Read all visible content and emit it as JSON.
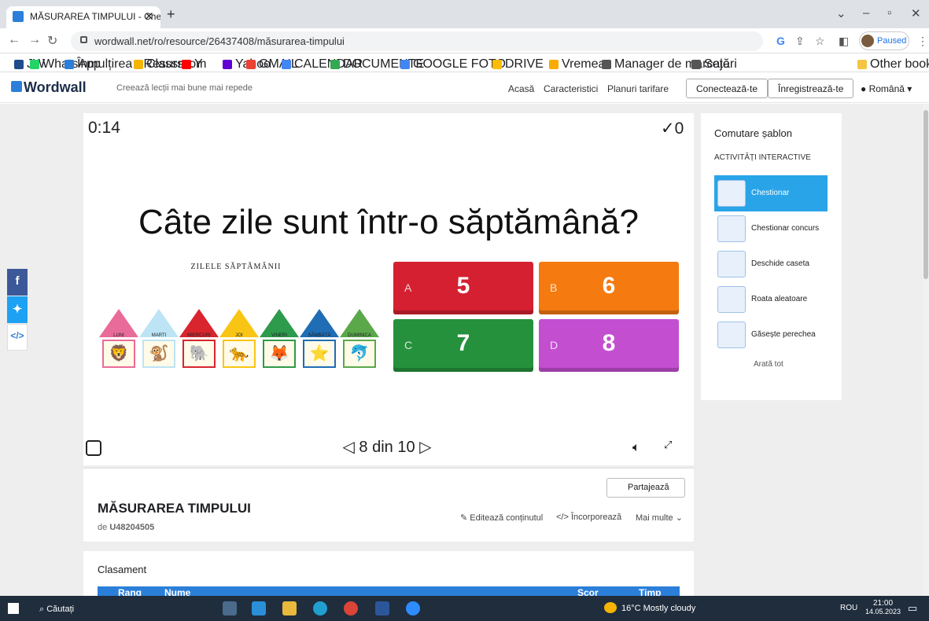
{
  "browser": {
    "tab_title": "MĂSURAREA TIMPULUI - Chestio",
    "url": "wordwall.net/ro/resource/26437408/măsurarea-timpului",
    "profile_status": "Paused",
    "bookmarks": [
      {
        "label": "JW",
        "color": "#1f4c8c"
      },
      {
        "label": "WhatsApp",
        "color": "#25d366"
      },
      {
        "label": "Înmulțirea - Resurs...",
        "color": "#2b7fd9"
      },
      {
        "label": "Classroom",
        "color": "#f4b400"
      },
      {
        "label": "Y",
        "color": "#ff0000"
      },
      {
        "label": "Yahoo",
        "color": "#6001d2"
      },
      {
        "label": "GMAIL",
        "color": "#ea4335"
      },
      {
        "label": "CALENDAR",
        "color": "#4285f4"
      },
      {
        "label": "DOCUMENTE",
        "color": "#34a853"
      },
      {
        "label": "GOOGLE FOTO",
        "color": "#4285f4"
      },
      {
        "label": "DRIVE",
        "color": "#fbbc04"
      },
      {
        "label": "Vremea",
        "color": "#f9ab00"
      },
      {
        "label": "Manager de marcaje",
        "color": "#555555"
      },
      {
        "label": "Setări",
        "color": "#555555"
      }
    ],
    "other_bookmarks": "Other bookmarks"
  },
  "site": {
    "logo": "Wordwall",
    "tagline": "Creează lecții mai bune mai repede",
    "nav": [
      "Acasă",
      "Caracteristici",
      "Planuri tarifare"
    ],
    "login": "Conectează-te",
    "register": "Înregistrează-te",
    "language": "Română"
  },
  "game": {
    "timer": "0:14",
    "score": "0",
    "question": "Câte zile sunt într-o săptămână?",
    "image_title": "ZILELE SĂPTĂMÂNII",
    "days": [
      {
        "name": "LUNI",
        "roof": "#e96b9a",
        "animal": "🦁"
      },
      {
        "name": "MARTI",
        "roof": "#bde4f4",
        "animal": "🐒"
      },
      {
        "name": "MIERCURI",
        "roof": "#d8252e",
        "animal": "🐘"
      },
      {
        "name": "JOI",
        "roof": "#f9c515",
        "animal": "🐆"
      },
      {
        "name": "VINERI",
        "roof": "#2e9a4b",
        "animal": "🦊"
      },
      {
        "name": "SÂMBĂTĂ",
        "roof": "#1f6db5",
        "animal": "⭐"
      },
      {
        "name": "DUMINICA",
        "roof": "#5aa84a",
        "animal": "🐬"
      }
    ],
    "answers": [
      {
        "letter": "A",
        "value": "5",
        "color": "#d42030"
      },
      {
        "letter": "B",
        "value": "6",
        "color": "#f57a10"
      },
      {
        "letter": "C",
        "value": "7",
        "color": "#25913c"
      },
      {
        "letter": "D",
        "value": "8",
        "color": "#c34fd0"
      }
    ],
    "pager": "8 din 10"
  },
  "activity": {
    "title": "MĂSURAREA TIMPULUI",
    "author_prefix": "de",
    "author": "U48204505",
    "share": "Partajează",
    "edit": "Editează conținutul",
    "embed": "Încorporează",
    "more": "Mai multe"
  },
  "leaderboard": {
    "title": "Clasament",
    "columns": [
      "Rang",
      "Nume",
      "Scor",
      "Timp"
    ]
  },
  "sidebar": {
    "title": "Comutare șablon",
    "subtitle": "ACTIVITĂȚI INTERACTIVE",
    "templates": [
      "Chestionar",
      "Chestionar concurs",
      "Deschide caseta",
      "Roata aleatoare",
      "Găsește perechea"
    ],
    "show_all": "Arată tot"
  },
  "taskbar": {
    "search": "Căutați",
    "weather": "16°C Mostly cloudy",
    "lang": "ROU",
    "time": "21:00",
    "date": "14.05.2023"
  }
}
